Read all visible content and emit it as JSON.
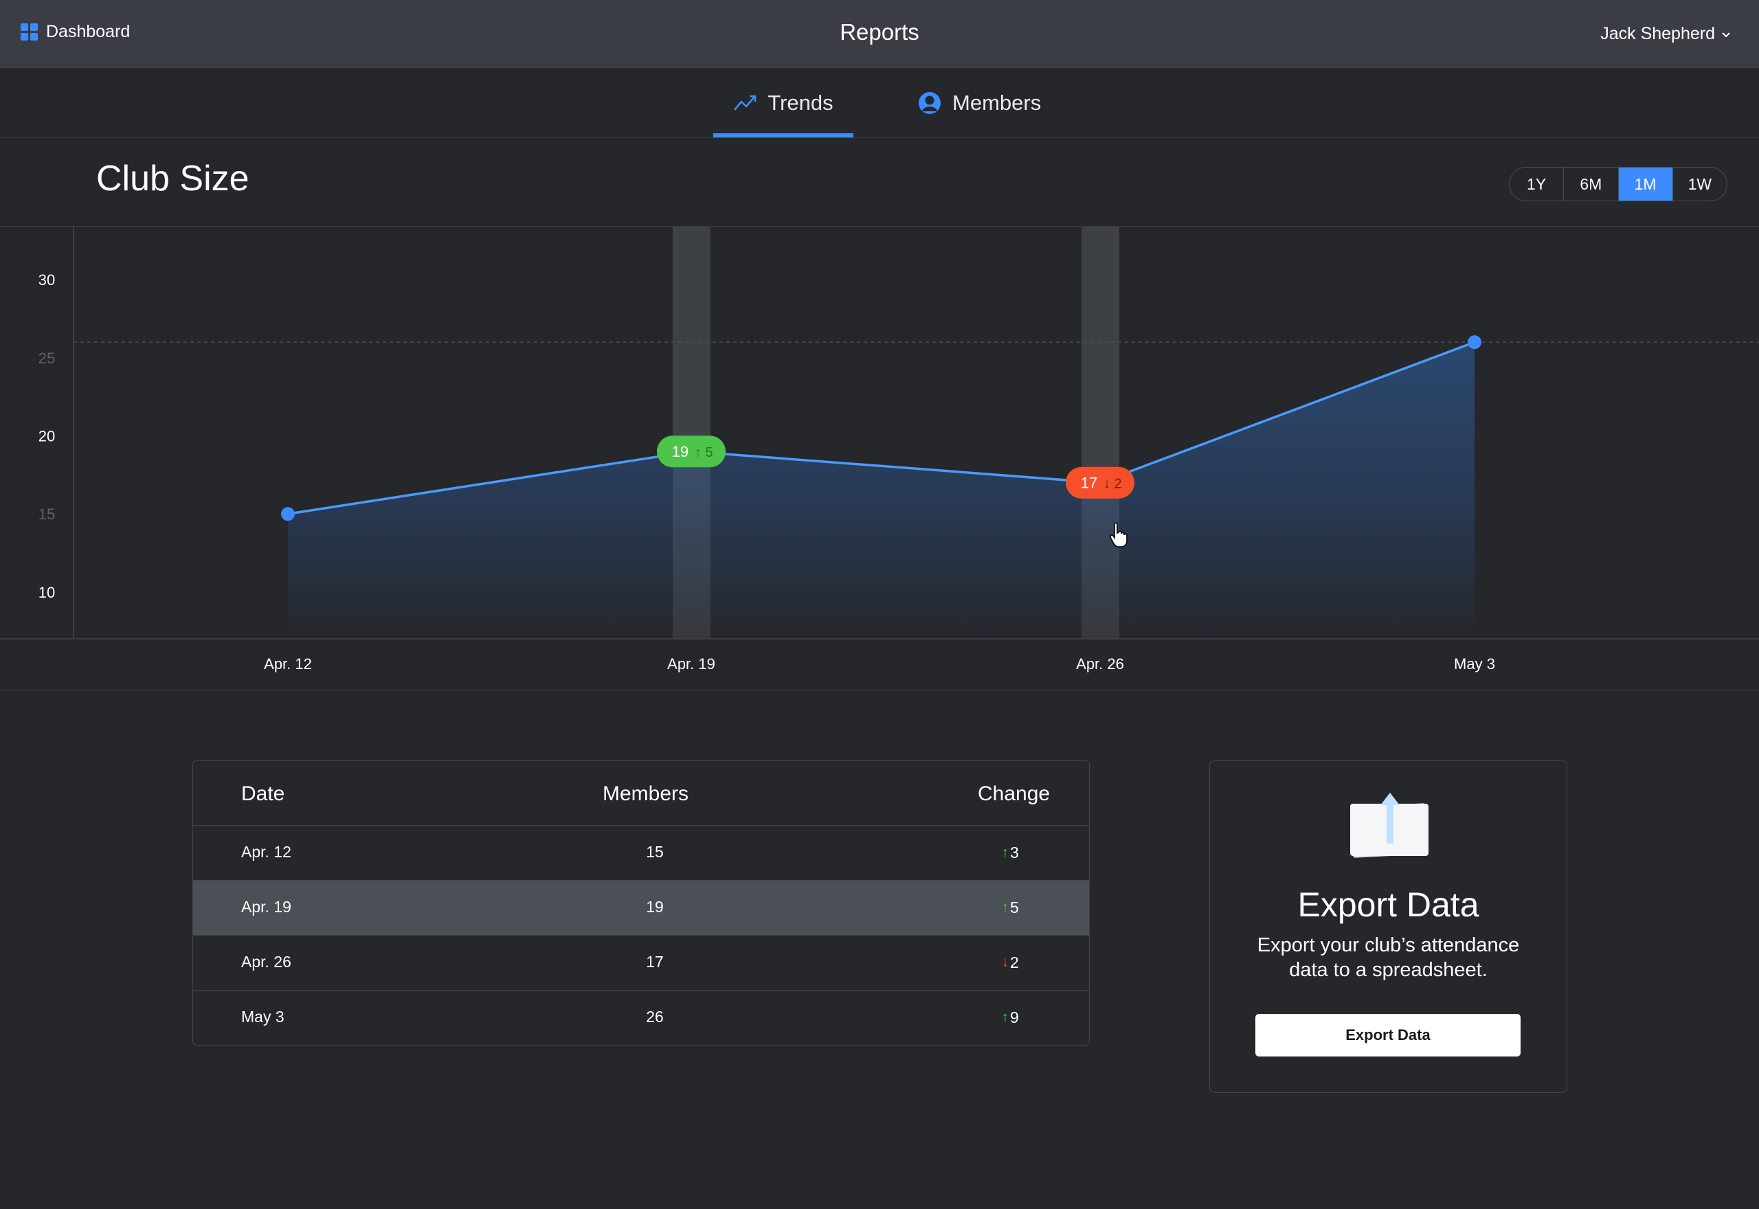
{
  "header": {
    "dashboard_label": "Dashboard",
    "title": "Reports",
    "user_name": "Jack Shepherd"
  },
  "tabs": [
    {
      "label": "Trends",
      "icon": "trend-line-icon",
      "active": true
    },
    {
      "label": "Members",
      "icon": "user-avatar-icon",
      "active": false
    }
  ],
  "chart_header": {
    "title": "Club Size",
    "ranges": [
      "1Y",
      "6M",
      "1M",
      "1W"
    ],
    "active_range": "1M"
  },
  "chart_data": {
    "type": "area",
    "title": "Club Size",
    "x": [
      "Apr. 12",
      "Apr. 19",
      "Apr. 26",
      "May 3"
    ],
    "values": [
      15,
      19,
      17,
      26
    ],
    "y_ticks": [
      10,
      15,
      20,
      25,
      30
    ],
    "ylim": [
      7,
      33
    ],
    "reference_line": 26,
    "markers": [
      {
        "x": "Apr. 19",
        "value": "19",
        "change": "5",
        "direction": "up",
        "color": "#4dc54a"
      },
      {
        "x": "Apr. 26",
        "value": "17",
        "change": "2",
        "direction": "down",
        "color": "#f5502a"
      }
    ],
    "highlight_columns": [
      "Apr. 19",
      "Apr. 26"
    ],
    "colors": {
      "line": "#4a9bff",
      "fill_top": "#2c4a74",
      "fill_bottom": "#25272b",
      "point": "#3d8cff",
      "highlight": "#3d4045"
    }
  },
  "table": {
    "headers": {
      "date": "Date",
      "members": "Members",
      "change": "Change"
    },
    "rows": [
      {
        "date": "Apr. 12",
        "members": "15",
        "change": "3",
        "direction": "up",
        "selected": false
      },
      {
        "date": "Apr. 19",
        "members": "19",
        "change": "5",
        "direction": "up",
        "selected": true
      },
      {
        "date": "Apr. 26",
        "members": "17",
        "change": "2",
        "direction": "down",
        "selected": false
      },
      {
        "date": "May 3",
        "members": "26",
        "change": "9",
        "direction": "up",
        "selected": false
      }
    ]
  },
  "export": {
    "title": "Export Data",
    "description": "Export your club’s attendance data to a spreadsheet.",
    "button_label": "Export Data",
    "icon": "export-document-icon"
  },
  "colors": {
    "accent": "#3d8cff",
    "background": "#25272b",
    "topbar": "#3a3d44",
    "up": "#3fd354",
    "down": "#ff4a2d"
  }
}
